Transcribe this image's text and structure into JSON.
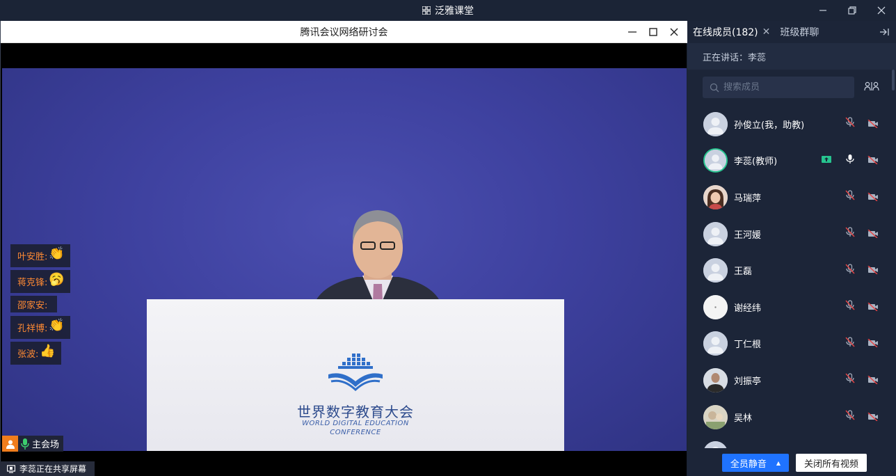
{
  "app": {
    "title": "泛雅课堂"
  },
  "meeting": {
    "title": "腾讯会议网络研讨会"
  },
  "video": {
    "podium_cn": "世界数字教育大会",
    "podium_en_line1": "WORLD DIGITAL EDUCATION",
    "podium_en_line2": "CONFERENCE"
  },
  "reactions": [
    {
      "name": "叶安胜:",
      "emoji": "👏"
    },
    {
      "name": "蒋克锋:",
      "emoji": "🥱"
    },
    {
      "name": "邵家安:",
      "emoji": ""
    },
    {
      "name": "孔祥博:",
      "emoji": "👏"
    },
    {
      "name": "张波:",
      "emoji": "👍"
    }
  ],
  "venue": {
    "label": "主会场"
  },
  "share_status": "李蕊正在共享屏幕",
  "panel": {
    "tab_members": "在线成员(182)",
    "tab_chat": "班级群聊",
    "speaking": "正在讲话：李蕊",
    "search_placeholder": "搜索成员",
    "members": [
      {
        "name": "孙俊立(我，助教)",
        "mic": "muted",
        "cam": "off"
      },
      {
        "name": "李蕊(教师)",
        "mic": "on",
        "cam": "off",
        "sharing": true
      },
      {
        "name": "马瑞萍",
        "mic": "muted",
        "cam": "off"
      },
      {
        "name": "王河媛",
        "mic": "muted",
        "cam": "off"
      },
      {
        "name": "王磊",
        "mic": "muted",
        "cam": "off"
      },
      {
        "name": "谢经纬",
        "mic": "muted",
        "cam": "off"
      },
      {
        "name": "丁仁根",
        "mic": "muted",
        "cam": "off"
      },
      {
        "name": "刘振亭",
        "mic": "muted",
        "cam": "off"
      },
      {
        "name": "吴林",
        "mic": "muted",
        "cam": "off"
      }
    ],
    "mute_all": "全员静音",
    "close_all_video": "关闭所有视频"
  },
  "colors": {
    "accent": "#1f73ff",
    "active_ring": "#27c48f",
    "reaction_text": "#ff8a33"
  }
}
